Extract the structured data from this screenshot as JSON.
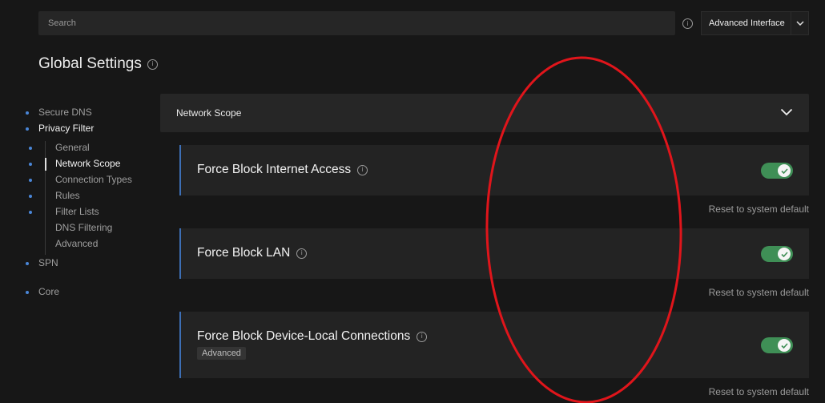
{
  "search": {
    "placeholder": "Search"
  },
  "mode_select": {
    "selected": "Advanced Interface"
  },
  "page": {
    "title": "Global Settings"
  },
  "sidebar": {
    "items": [
      {
        "label": "Secure DNS"
      },
      {
        "label": "Privacy Filter"
      },
      {
        "label": "SPN"
      },
      {
        "label": "Core"
      }
    ],
    "sub_items": [
      {
        "label": "General"
      },
      {
        "label": "Network Scope"
      },
      {
        "label": "Connection Types"
      },
      {
        "label": "Rules"
      },
      {
        "label": "Filter Lists"
      },
      {
        "label": "DNS Filtering"
      },
      {
        "label": "Advanced"
      }
    ]
  },
  "section": {
    "title": "Network Scope"
  },
  "settings": [
    {
      "title": "Force Block Internet Access",
      "enabled": true,
      "reset_label": "Reset to system default"
    },
    {
      "title": "Force Block LAN",
      "enabled": true,
      "reset_label": "Reset to system default"
    },
    {
      "title": "Force Block Device-Local Connections",
      "badge": "Advanced",
      "enabled": true,
      "reset_label": "Reset to system default"
    }
  ],
  "colors": {
    "background": "#171717",
    "toggle_on": "#3f8f56",
    "accent_blue": "#3d6fb5",
    "annotation": "#e0151b"
  }
}
